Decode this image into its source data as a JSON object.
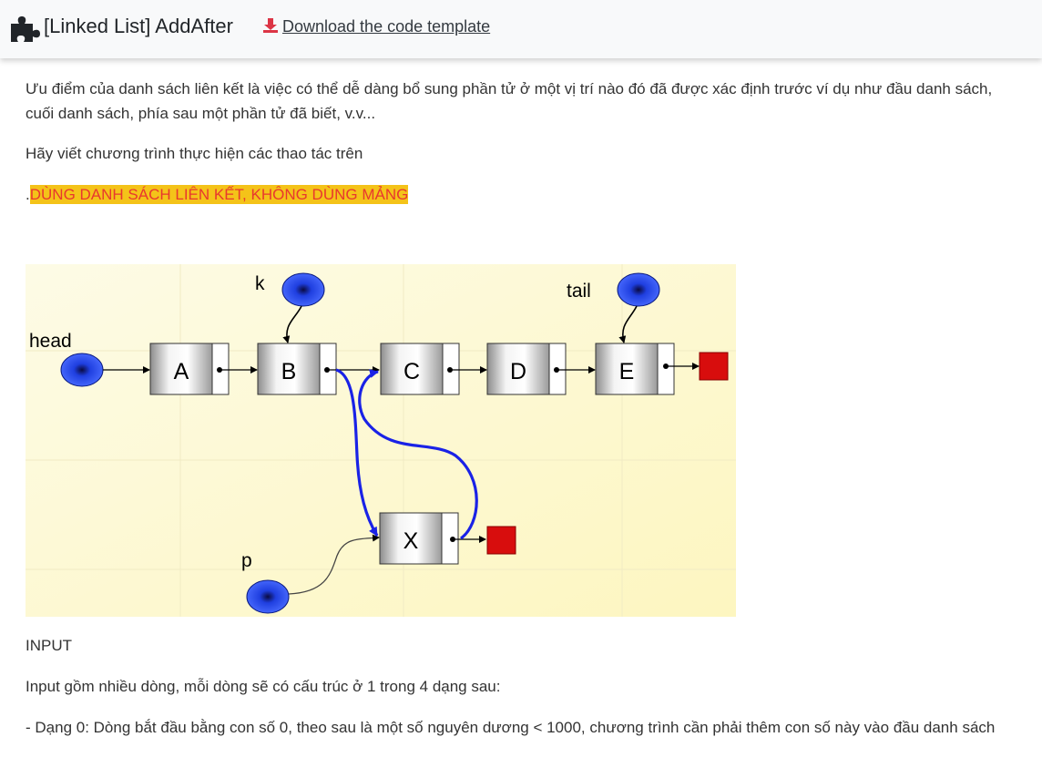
{
  "header": {
    "title": "[Linked List] AddAfter",
    "download_label": "Download the code template",
    "icons": {
      "app": "puzzle-piece-icon",
      "download": "download-icon"
    }
  },
  "content": {
    "paragraph1": "Ưu điểm của danh sách liên kết là việc có thể dễ dàng bổ sung phần tử ở một vị trí nào đó đã được xác định trước ví dụ như đầu danh sách, cuối danh sách, phía sau một phần tử đã biết, v.v...",
    "paragraph2": "Hãy viết chương trình thực hiện các thao tác trên",
    "warning_prefix": ".",
    "warning": "DÙNG DANH SÁCH LIÊN KẾT, KHÔNG DÙNG MẢNG",
    "input_heading": "INPUT",
    "input_desc": "Input gồm nhiều dòng, mỗi dòng sẽ có cấu trúc ở 1 trong 4 dạng sau:",
    "input_type0": "- Dạng 0: Dòng bắt đầu bằng con số 0, theo sau là một số nguyên dương < 1000, chương trình cần phải thêm con số này vào đầu danh sách"
  },
  "diagram": {
    "labels": {
      "head": "head",
      "k": "k",
      "tail": "tail",
      "p": "p"
    },
    "nodes": [
      "A",
      "B",
      "C",
      "D",
      "E"
    ],
    "new_node": "X",
    "colors": {
      "pointer_circle": "#1f3fe0",
      "null_square": "#d80d0d",
      "new_links": "#1a22e6",
      "background": "#fdf9d6",
      "highlight_bg": "#f4c319",
      "highlight_text": "#e8382e"
    }
  }
}
